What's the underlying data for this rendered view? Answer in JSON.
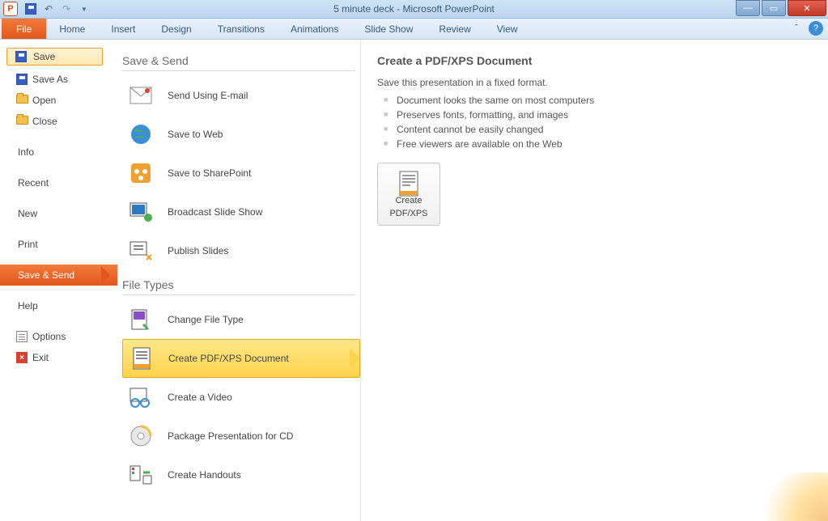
{
  "window": {
    "title": "5 minute deck - Microsoft PowerPoint",
    "app_letter": "P"
  },
  "ribbon": {
    "tabs": [
      "File",
      "Home",
      "Insert",
      "Design",
      "Transitions",
      "Animations",
      "Slide Show",
      "Review",
      "View"
    ]
  },
  "sidebar": {
    "save": "Save",
    "save_as": "Save As",
    "open": "Open",
    "close": "Close",
    "info": "Info",
    "recent": "Recent",
    "new": "New",
    "print": "Print",
    "save_send": "Save & Send",
    "help": "Help",
    "options": "Options",
    "exit": "Exit"
  },
  "save_send": {
    "heading": "Save & Send",
    "items": {
      "email": "Send Using E-mail",
      "web": "Save to Web",
      "sharepoint": "Save to SharePoint",
      "broadcast": "Broadcast Slide Show",
      "publish": "Publish Slides"
    },
    "file_types_heading": "File Types",
    "file_types": {
      "change": "Change File Type",
      "pdf": "Create PDF/XPS Document",
      "video": "Create a Video",
      "package": "Package Presentation for CD",
      "handouts": "Create Handouts"
    }
  },
  "right": {
    "heading": "Create a PDF/XPS Document",
    "subtitle": "Save this presentation in a fixed format.",
    "bullets": [
      "Document looks the same on most computers",
      "Preserves fonts, formatting, and images",
      "Content cannot be easily changed",
      "Free viewers are available on the Web"
    ],
    "button_l1": "Create",
    "button_l2": "PDF/XPS"
  }
}
